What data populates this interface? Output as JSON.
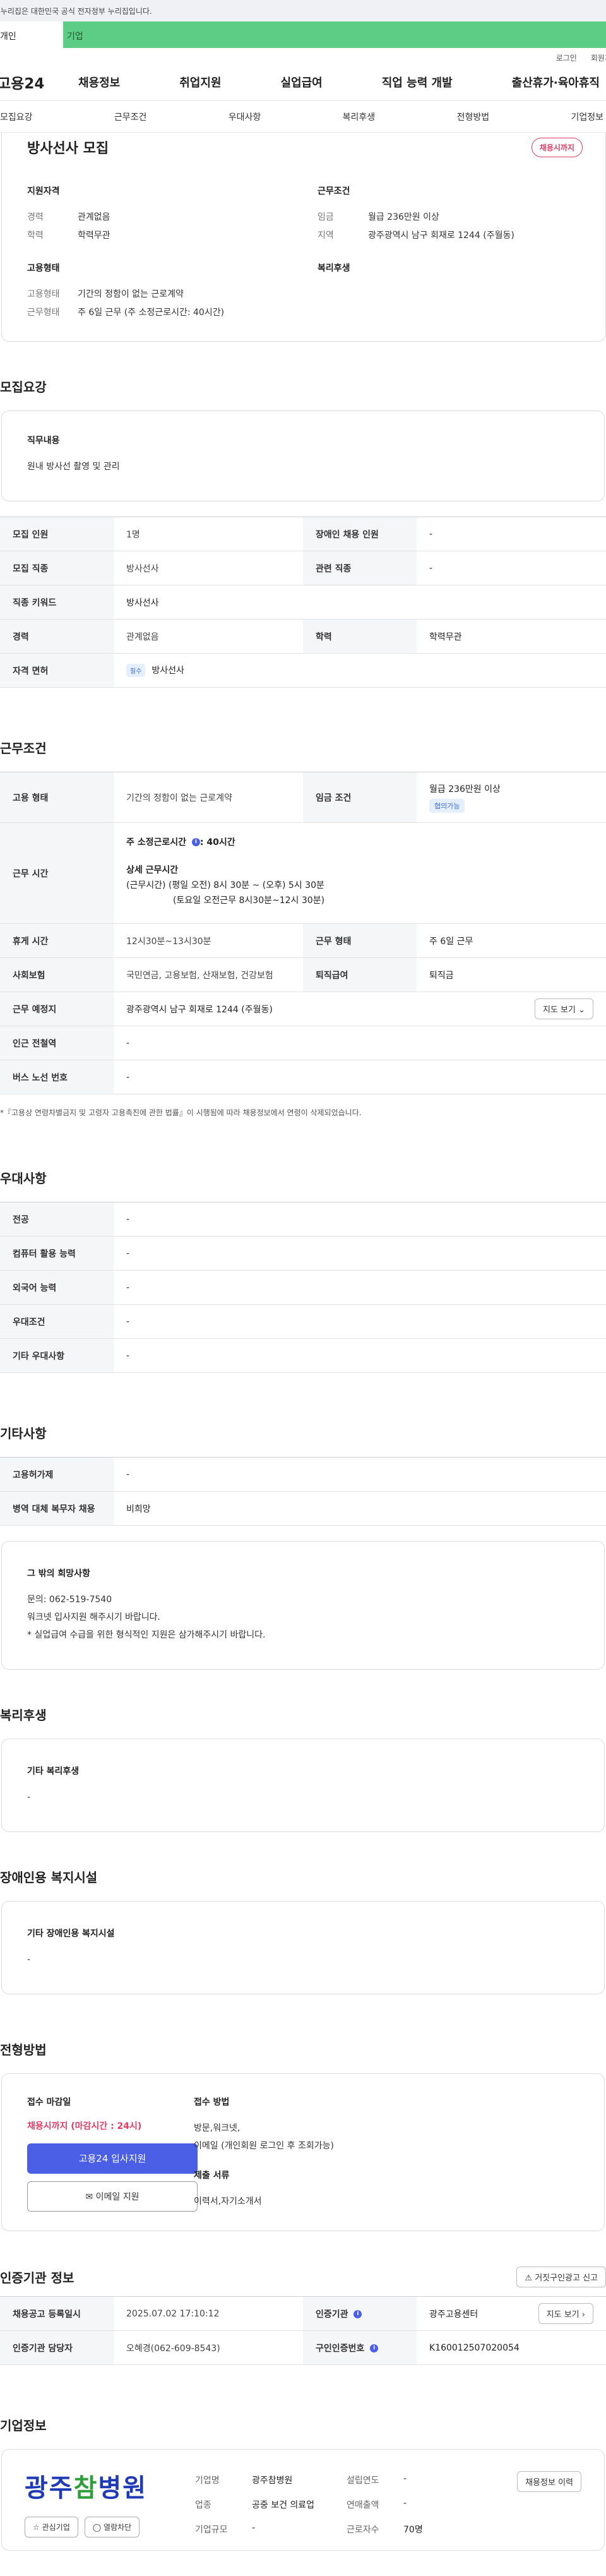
{
  "notice": "이 누리집은 대한민국 공식 전자정부 누리집입니다.",
  "top_tabs": {
    "personal": "개인",
    "company": "기업"
  },
  "util": {
    "login": "로그인",
    "join": "회원가입"
  },
  "gnb": {
    "logo": "고용24",
    "menu": [
      "채용정보",
      "취업지원",
      "실업급여",
      "직업 능력 개발",
      "출산휴가·육아휴직"
    ]
  },
  "subnav": [
    "모집요강",
    "근무조건",
    "우대사항",
    "복리후생",
    "전형방법",
    "기업정보"
  ],
  "summary": {
    "title": "방사선사 모집",
    "badge": "채용시까지",
    "qual_title": "지원자격",
    "career_k": "경력",
    "career_v": "관계없음",
    "edu_k": "학력",
    "edu_v": "학력무관",
    "work_title": "근무조건",
    "wage_k": "임금",
    "wage_v": "월급 236만원 이상",
    "region_k": "지역",
    "region_v": "광주광역시 남구 회재로 1244 (주월동)",
    "emp_title": "고용형태",
    "emp_k": "고용형태",
    "emp_v": "기간의 정함이 없는 근로계약",
    "shift_k": "근무형태",
    "shift_v": "주 6일 근무 (주 소정근로시간: 40시간)",
    "welfare_title": "복리후생"
  },
  "recruit": {
    "section": "모집요강",
    "job_title": "직무내용",
    "job_desc": "원내 방사선 촬영 및 관리",
    "rows": {
      "count_k": "모집 인원",
      "count_v": "1명",
      "dis_k": "장애인 채용 인원",
      "dis_v": "-",
      "job_k": "모집 직종",
      "job_v": "방사선사",
      "rel_k": "관련 직종",
      "rel_v": "-",
      "kw_k": "직종 키워드",
      "kw_v": "방사선사",
      "car_k": "경력",
      "car_v": "관계없음",
      "edu_k": "학력",
      "edu_v": "학력무관",
      "lic_k": "자격 면허",
      "lic_chip": "필수",
      "lic_v": "방사선사"
    }
  },
  "work": {
    "section": "근무조건",
    "type_k": "고용 형태",
    "type_v": "기간의 정함이 없는 근로계약",
    "wage_k": "임금 조건",
    "wage_v": "월급 236만원 이상",
    "wage_chip": "협의가능",
    "time_k": "근무 시간",
    "time_week": "주 소정근로시간",
    "time_week_v": ": 40시간",
    "time_detail_title": "상세 근무시간",
    "time_l1": "(근무시간) (평일 오전) 8시 30분 ~ (오후) 5시 30분",
    "time_l2": "(토요일 오전근무 8시30분~12시 30분)",
    "rest_k": "휴게 시간",
    "rest_v": "12시30분~13시30분",
    "shift_k": "근무 형태",
    "shift_v": "주 6일 근무",
    "ins_k": "사회보험",
    "ins_v": "국민연금, 고용보험, 산재보험, 건강보험",
    "ret_k": "퇴직급여",
    "ret_v": "퇴직금",
    "place_k": "근무 예정지",
    "place_v": "광주광역시 남구 회재로 1244 (주월동)",
    "map_btn": "지도 보기",
    "sub_k": "인근 전철역",
    "sub_v": "-",
    "bus_k": "버스 노선 번호",
    "bus_v": "-",
    "note": "*『고용상 연령차별금지 및 고령자 고용촉진에 관한 법률』이 시행됨에 따라 채용정보에서 연령이 삭제되었습니다."
  },
  "pref": {
    "section": "우대사항",
    "major_k": "전공",
    "major_v": "-",
    "pc_k": "컴퓨터 활용 능력",
    "pc_v": "-",
    "lang_k": "외국어 능력",
    "lang_v": "-",
    "cond_k": "우대조건",
    "cond_v": "-",
    "etc_k": "기타 우대사항",
    "etc_v": "-"
  },
  "other": {
    "section": "기타사항",
    "permit_k": "고용허가제",
    "permit_v": "-",
    "mil_k": "병역 대체 복무자 채용",
    "mil_v": "비희망",
    "req_title": "그 밖의 희망사항",
    "req_l1": "문의: 062-519-7540",
    "req_l2": "워크넷 입사지원 해주시기 바랍니다.",
    "req_l3": "* 실업급여 수급을 위한 형식적인 지원은 삼가해주시기 바랍니다."
  },
  "welfare": {
    "section": "복리후생",
    "title": "기타 복리후생",
    "value": "-"
  },
  "disability": {
    "section": "장애인용 복지시설",
    "title": "기타 장애인용 복지시설",
    "value": "-"
  },
  "apply": {
    "section": "전형방법",
    "deadline_title": "접수 마감일",
    "deadline_v": "채용시까지 (마감시간 : 24시)",
    "apply_btn": "고용24 입사지원",
    "email_btn": "이메일 지원",
    "method_title": "접수 방법",
    "method_l1": "방문,워크넷,",
    "method_l2": "이메일 (개인회원 로그인 후 조회가능)",
    "docs_title": "제출 서류",
    "docs_v": "이력서,자기소개서"
  },
  "cert": {
    "section": "인증기관 정보",
    "report_btn": "거짓구인광고 신고",
    "reg_k": "채용공고 등록일시",
    "reg_v": "2025.07.02 17:10:12",
    "org_k": "인증기관",
    "org_v": "광주고용센터",
    "map_btn": "지도 보기",
    "mgr_k": "인증기관 담당자",
    "mgr_v": "오혜경(062-609-8543)",
    "num_k": "구인인증번호",
    "num_v": "K160012507020054"
  },
  "company": {
    "section": "기업정보",
    "logo_a": "광주",
    "logo_b": "참",
    "logo_c": "병원",
    "interest_btn": "관심기업",
    "block_btn": "열람차단",
    "name_k": "기업명",
    "name_v": "광주참병원",
    "year_k": "설립연도",
    "year_v": "-",
    "ind_k": "업종",
    "ind_v": "공중 보건 의료업",
    "sales_k": "연매출액",
    "sales_v": "-",
    "size_k": "기업규모",
    "size_v": "-",
    "emp_k": "근로자수",
    "emp_v": "70명",
    "history_btn": "채용정보 이력"
  }
}
